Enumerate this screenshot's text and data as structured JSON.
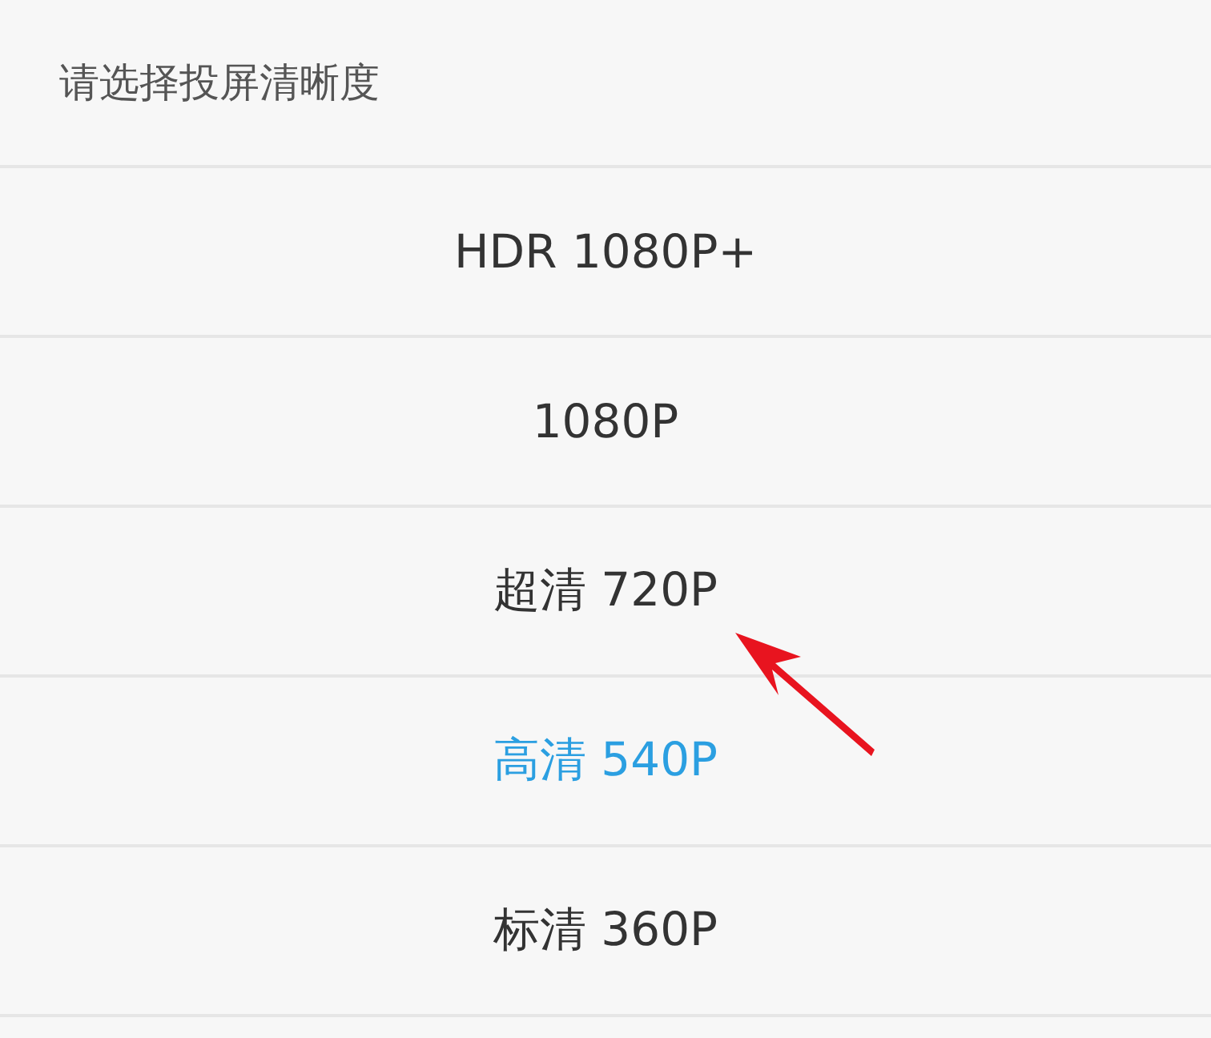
{
  "dialog": {
    "title": "请选择投屏清晰度",
    "options": [
      {
        "label": "HDR 1080P+",
        "selected": false
      },
      {
        "label": "1080P",
        "selected": false
      },
      {
        "label": "超清 720P",
        "selected": false
      },
      {
        "label": "高清 540P",
        "selected": true
      },
      {
        "label": "标清 360P",
        "selected": false
      }
    ]
  }
}
